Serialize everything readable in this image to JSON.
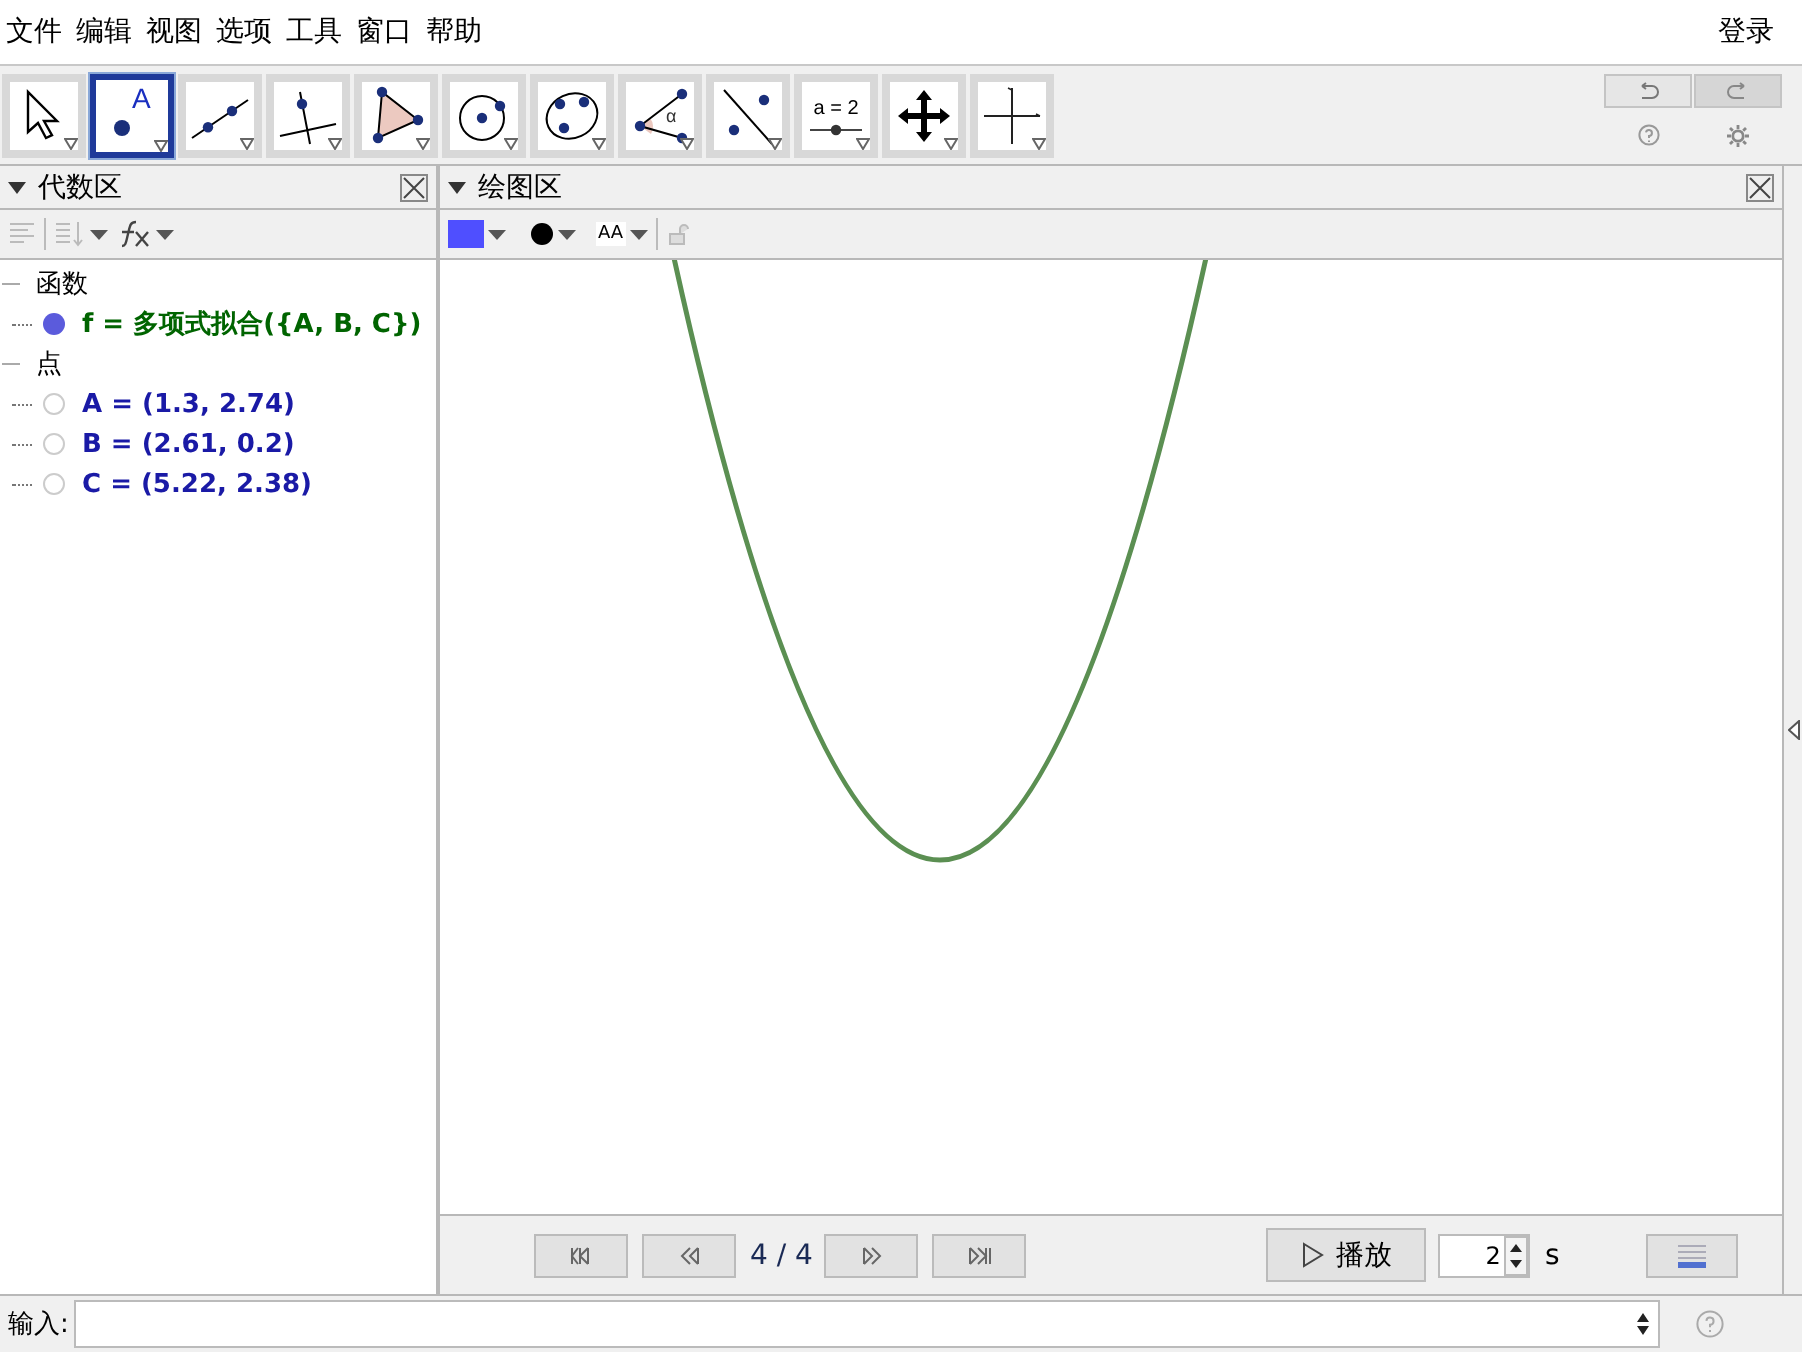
{
  "menu": [
    "文件",
    "编辑",
    "视图",
    "选项",
    "工具",
    "窗口",
    "帮助"
  ],
  "login": "登录",
  "tools": [
    {
      "kind": "move",
      "selected": false
    },
    {
      "kind": "point",
      "label": "A",
      "selected": true
    },
    {
      "kind": "line",
      "selected": false
    },
    {
      "kind": "perpendicular",
      "selected": false
    },
    {
      "kind": "polygon",
      "selected": false
    },
    {
      "kind": "circle",
      "selected": false
    },
    {
      "kind": "conic",
      "selected": false
    },
    {
      "kind": "angle",
      "label": "α",
      "selected": false
    },
    {
      "kind": "reflect",
      "selected": false
    },
    {
      "kind": "slider",
      "label": "a = 2",
      "selected": false
    },
    {
      "kind": "move_view",
      "selected": false
    },
    {
      "kind": "axes",
      "selected": false
    }
  ],
  "algebra": {
    "title": "代数区",
    "groups": [
      {
        "label": "函数",
        "expanded": true,
        "children": [
          {
            "text": "f = 多项式拟合({A, B, C})",
            "visible": true,
            "color": "#006400"
          }
        ]
      },
      {
        "label": "点",
        "expanded": true,
        "children": [
          {
            "text": "A = (1.3, 2.74)",
            "visible": false,
            "color": "#1a1aa6"
          },
          {
            "text": "B = (2.61, 0.2)",
            "visible": false,
            "color": "#1a1aa6"
          },
          {
            "text": "C = (5.22, 2.38)",
            "visible": false,
            "color": "#1a1aa6"
          }
        ]
      }
    ]
  },
  "graphics": {
    "title": "绘图区",
    "style": {
      "color": "#4f4fff",
      "size_label": "AA"
    }
  },
  "animation": {
    "step": "4 / 4",
    "play": "播放",
    "speed": "2",
    "unit": "s"
  },
  "input": {
    "label": "输入:"
  }
}
